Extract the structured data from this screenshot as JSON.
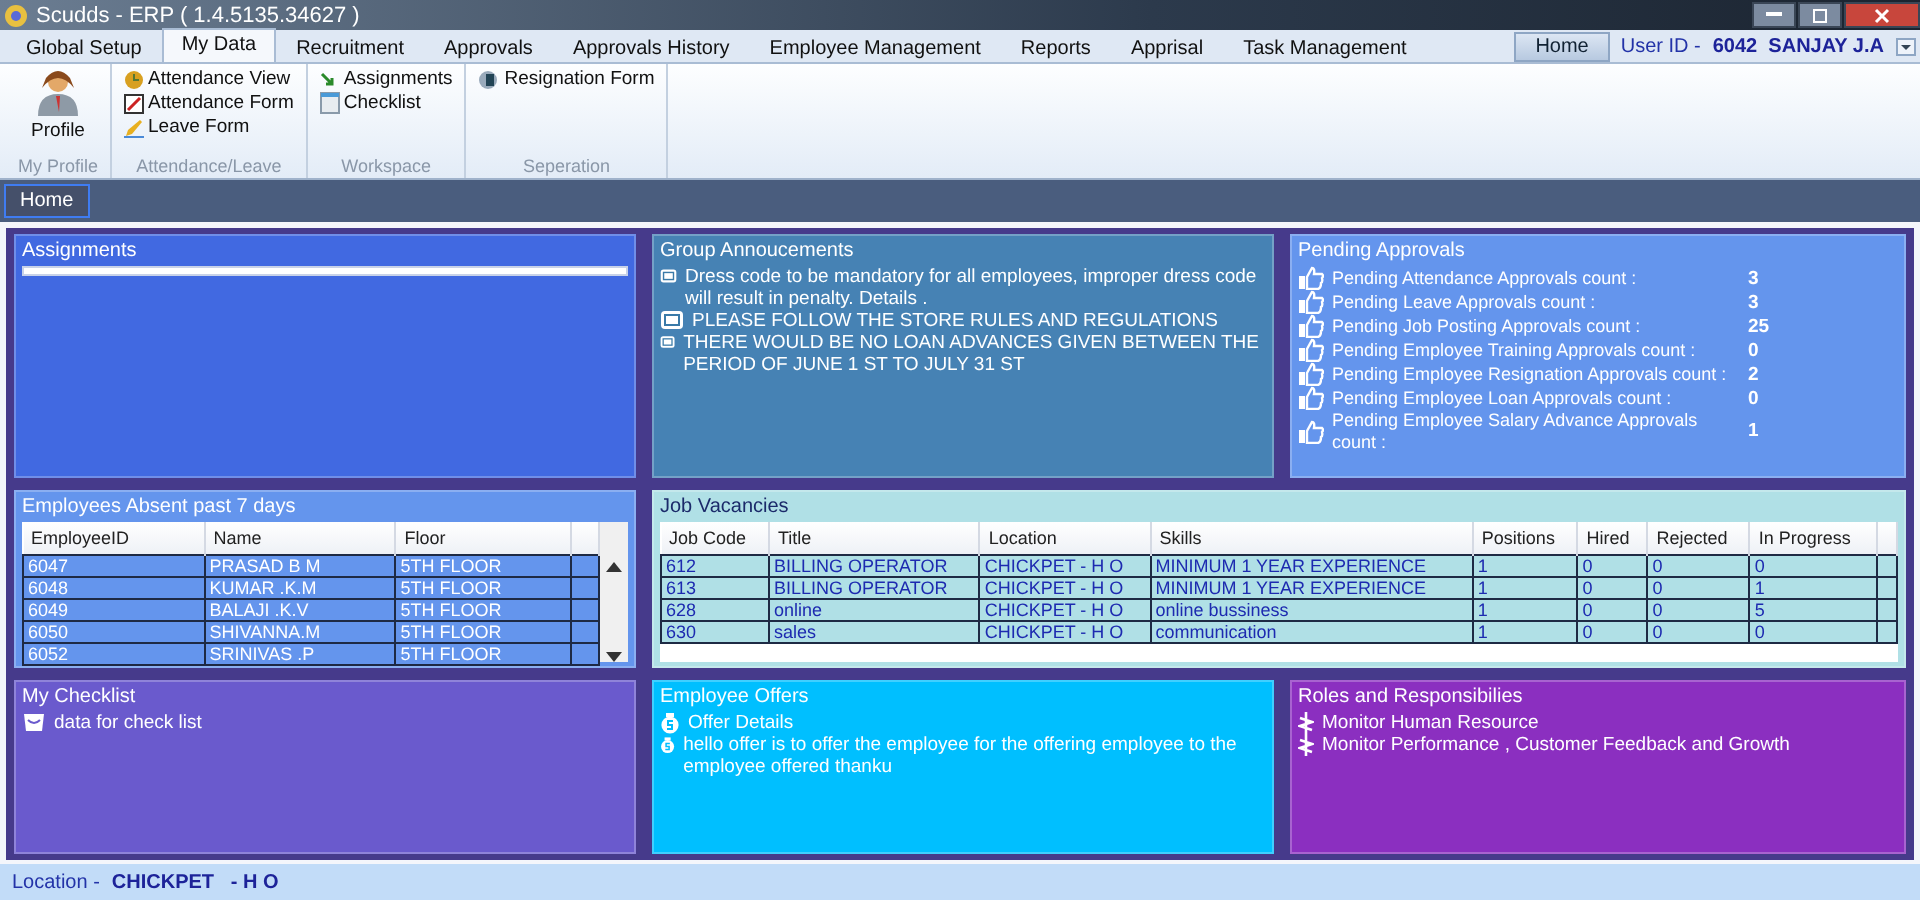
{
  "window": {
    "title": "Scudds - ERP ( 1.4.5135.34627 )"
  },
  "menu_tabs": [
    {
      "label": "Global Setup",
      "selected": false
    },
    {
      "label": "My Data",
      "selected": true
    },
    {
      "label": "Recruitment",
      "selected": false
    },
    {
      "label": "Approvals",
      "selected": false
    },
    {
      "label": "Approvals History",
      "selected": false
    },
    {
      "label": "Employee Management",
      "selected": false
    },
    {
      "label": "Reports",
      "selected": false
    },
    {
      "label": "Apprisal",
      "selected": false
    },
    {
      "label": "Task Management",
      "selected": false
    }
  ],
  "header": {
    "home_button": "Home",
    "user_label": "User ID -",
    "user_value": "6042  SANJAY J.A"
  },
  "ribbon": [
    {
      "label": "My Profile",
      "items": [
        {
          "label": "Profile"
        }
      ]
    },
    {
      "label": "Attendance/Leave",
      "items": [
        {
          "label": "Attendance View"
        },
        {
          "label": "Attendance Form"
        },
        {
          "label": "Leave Form"
        }
      ]
    },
    {
      "label": "Workspace",
      "items": [
        {
          "label": "Assignments"
        },
        {
          "label": "Checklist"
        }
      ]
    },
    {
      "label": "Seperation",
      "items": [
        {
          "label": "Resignation Form"
        }
      ]
    }
  ],
  "doc_tabs": [
    {
      "label": "Home",
      "selected": true
    }
  ],
  "assignments": {
    "title": "Assignments"
  },
  "announcements": {
    "title": "Group Annoucements",
    "items": [
      "Dress code to be mandatory for all employees, improper dress code will result in penalty. Details .",
      "PLEASE FOLLOW THE STORE RULES AND REGULATIONS",
      "THERE WOULD BE NO LOAN ADVANCES GIVEN BETWEEN THE PERIOD OF JUNE 1 ST TO JULY 31 ST"
    ]
  },
  "pending_approvals": {
    "title": "Pending Approvals",
    "items": [
      {
        "label": "Pending Attendance Approvals count :",
        "count": "3"
      },
      {
        "label": "Pending Leave Approvals count :",
        "count": "3"
      },
      {
        "label": "Pending Job Posting Approvals count :",
        "count": "25"
      },
      {
        "label": "Pending Employee Training Approvals count :",
        "count": "0"
      },
      {
        "label": "Pending Employee Resignation Approvals count :",
        "count": "2"
      },
      {
        "label": "Pending Employee Loan Approvals count :",
        "count": "0"
      },
      {
        "label": "Pending Employee Salary Advance Approvals count :",
        "count": "1"
      }
    ]
  },
  "absent": {
    "title": "Employees Absent past 7 days",
    "columns": [
      "EmployeeID",
      "Name",
      "Floor"
    ],
    "rows": [
      [
        "6047",
        "PRASAD B M",
        "5TH FLOOR"
      ],
      [
        "6048",
        "KUMAR .K.M",
        "5TH FLOOR"
      ],
      [
        "6049",
        "BALAJI .K.V",
        "5TH FLOOR"
      ],
      [
        "6050",
        "SHIVANNA.M",
        "5TH FLOOR"
      ],
      [
        "6052",
        "SRINIVAS .P",
        "5TH FLOOR"
      ]
    ]
  },
  "vacancies": {
    "title": "Job Vacancies",
    "columns": [
      "Job Code",
      "Title",
      "Location",
      "Skills",
      "Positions",
      "Hired",
      "Rejected",
      "In Progress"
    ],
    "rows": [
      [
        "612",
        "BILLING OPERATOR",
        "CHICKPET  - H O",
        "MINIMUM 1 YEAR EXPERIENCE",
        "1",
        "0",
        "0",
        "0"
      ],
      [
        "613",
        "BILLING OPERATOR",
        "CHICKPET  - H O",
        "MINIMUM 1 YEAR EXPERIENCE",
        "1",
        "0",
        "0",
        "1"
      ],
      [
        "628",
        "online",
        "CHICKPET  - H O",
        "online bussiness",
        "1",
        "0",
        "0",
        "5"
      ],
      [
        "630",
        "sales",
        "CHICKPET  - H O",
        "communication",
        "1",
        "0",
        "0",
        "0"
      ]
    ]
  },
  "checklist": {
    "title": "My Checklist",
    "items": [
      "data for check list"
    ]
  },
  "offers": {
    "title": "Employee Offers",
    "items": [
      "Offer Details",
      "hello offer is to offer the employee for the offering employee to the employee offered thanku"
    ]
  },
  "roles": {
    "title": "Roles and Responsibilies",
    "items": [
      "Monitor Human Resource",
      "Monitor Performance , Customer Feedback and Growth"
    ]
  },
  "status_bar": {
    "label": "Location -",
    "value": "CHICKPET   - H O"
  }
}
